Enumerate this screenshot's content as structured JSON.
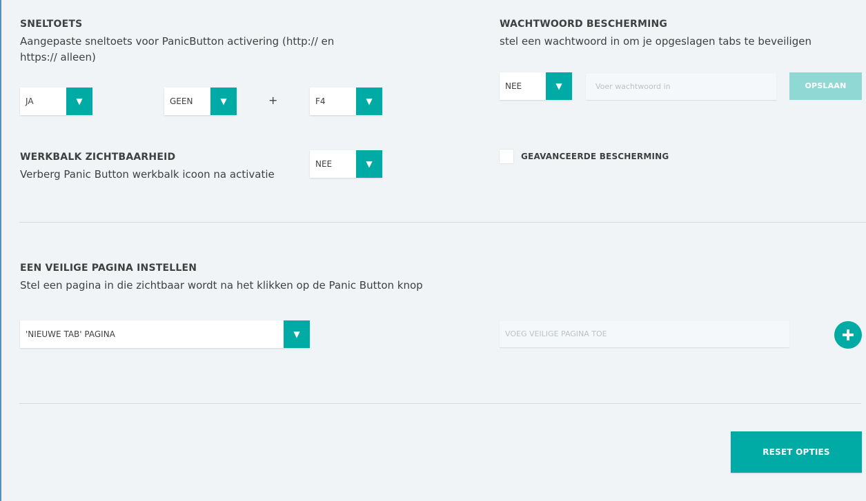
{
  "shortcut": {
    "title": "SNELTOETS",
    "desc_line1": "Aangepaste sneltoets voor PanicButton activering (http:// en",
    "desc_line2": "https:// alleen)",
    "enabled": "JA",
    "modifier": "GEEN",
    "plus": "+",
    "key": "F4"
  },
  "toolbar": {
    "title": "WERKBALK ZICHTBAARHEID",
    "desc": "Verberg Panic Button werkbalk icoon na activatie",
    "value": "NEE"
  },
  "password": {
    "title": "WACHTWOORD BESCHERMING",
    "desc": "stel een wachtwoord in om je opgeslagen tabs te beveiligen",
    "enabled": "NEE",
    "placeholder": "Voer wachtwoord in",
    "save_label": "OPSLAAN",
    "advanced_label": "GEAVANCEERDE BESCHERMING",
    "advanced_checked": false
  },
  "safe_page": {
    "title": "EEN VEILIGE PAGINA INSTELLEN",
    "desc": "Stel een pagina in die zichtbaar wordt na het klikken op de Panic Button knop",
    "selected": "'NIEUWE TAB' PAGINA",
    "placeholder": "VOEG VEILIGE PAGINA TOE",
    "add_icon": "plus-icon"
  },
  "reset_label": "RESET OPTIES",
  "colors": {
    "accent": "#00aaa5",
    "accent_disabled": "#8fd8d4",
    "background": "#f0f4f7"
  }
}
